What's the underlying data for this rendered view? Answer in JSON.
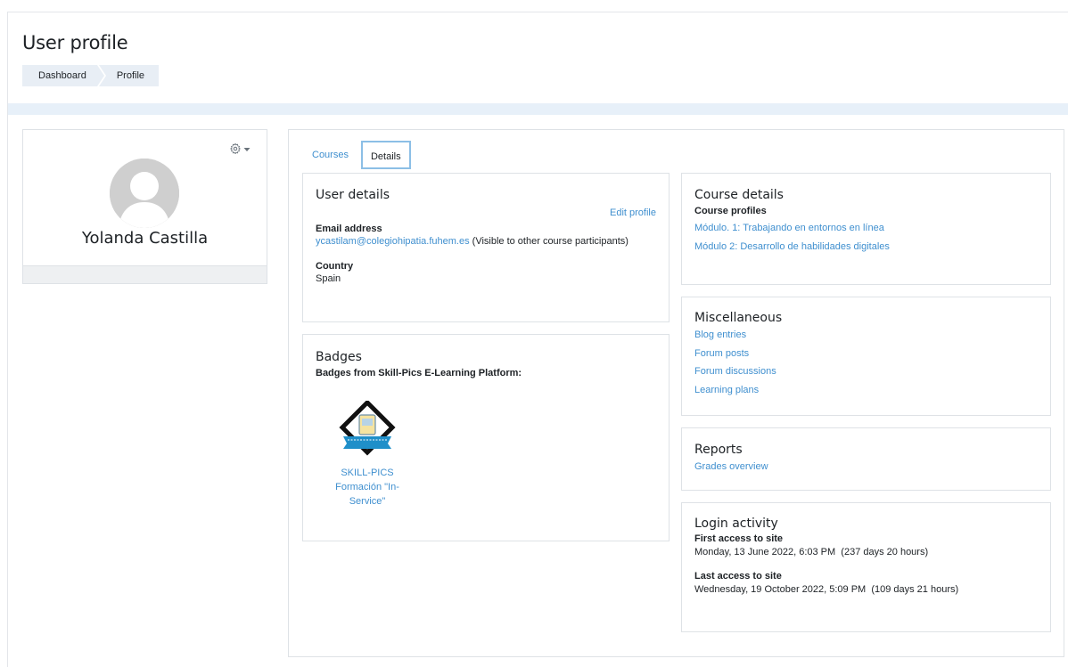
{
  "header": {
    "title": "User profile",
    "breadcrumb": [
      "Dashboard",
      "Profile"
    ]
  },
  "profile": {
    "name": "Yolanda Castilla"
  },
  "tabs": [
    {
      "label": "Courses",
      "active": false
    },
    {
      "label": "Details",
      "active": true
    }
  ],
  "user_details": {
    "heading": "User details",
    "edit_link": "Edit profile",
    "email_label": "Email address",
    "email_value": "ycastilam@colegiohipatia.fuhem.es",
    "email_note": "(Visible to other course participants)",
    "country_label": "Country",
    "country_value": "Spain"
  },
  "badges": {
    "heading": "Badges",
    "subheading": "Badges from Skill-Pics E-Learning Platform:",
    "items": [
      {
        "name_line1": "SKILL-PICS",
        "name_line2": "Formación \"In-",
        "name_line3": "Service\""
      }
    ]
  },
  "course_details": {
    "heading": "Course details",
    "profiles_label": "Course profiles",
    "courses": [
      "Módulo. 1: Trabajando en entornos en línea",
      "Módulo 2: Desarrollo de habilidades digitales"
    ]
  },
  "misc": {
    "heading": "Miscellaneous",
    "links": [
      "Blog entries",
      "Forum posts",
      "Forum discussions",
      "Learning plans"
    ]
  },
  "reports": {
    "heading": "Reports",
    "links": [
      "Grades overview"
    ]
  },
  "login": {
    "heading": "Login activity",
    "first_label": "First access to site",
    "first_value": "Monday, 13 June 2022, 6:03 PM  (237 days 20 hours)",
    "last_label": "Last access to site",
    "last_value": "Wednesday, 19 October 2022, 5:09 PM  (109 days 21 hours)"
  },
  "colors": {
    "link": "#3f8fcf",
    "band": "#e7f0f9",
    "tab_border": "#8cbfe6"
  }
}
